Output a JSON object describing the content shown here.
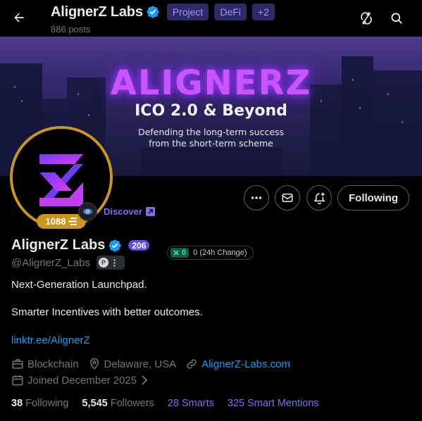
{
  "header": {
    "title": "AlignerZ Labs",
    "posts": "886 posts",
    "tags": [
      "Project",
      "DeFi",
      "+2"
    ]
  },
  "banner": {
    "logo": "ALIGNERZ",
    "headline": "ICO 2.0 & Beyond",
    "tagline_1": "Defending the long-term success",
    "tagline_2": "from the short-term scheme"
  },
  "avatar": {
    "score": "1088"
  },
  "discover": {
    "label": "Discover"
  },
  "actions": {
    "following_label": "Following"
  },
  "profile": {
    "name": "AlignerZ Labs",
    "count_badge": "206",
    "change_value": "0",
    "change_label": "0 (24h Change)",
    "handle": "@AlignerZ_Labs",
    "chip_letter": "P",
    "bio_line_1": "Next-Generation Launchpad.",
    "bio_line_2": "Smarter Incentives with better outcomes.",
    "link": "linktr.ee/AlignerZ",
    "category": "Blockchain",
    "location": "Delaware, USA",
    "website": "AlignerZ-Labs.com",
    "joined": "Joined December 2025"
  },
  "stats": {
    "following_count": "38",
    "following_label": "Following",
    "followers_count": "5,545",
    "followers_label": "Followers",
    "smarts": "28 Smarts",
    "smart_mentions": "325 Smart Mentions"
  },
  "colors": {
    "accent_purple": "#7b6ff0",
    "link_blue": "#1d9bf0",
    "gold_ring": "#c9961f",
    "verified_blue": "#1d9bf0"
  }
}
